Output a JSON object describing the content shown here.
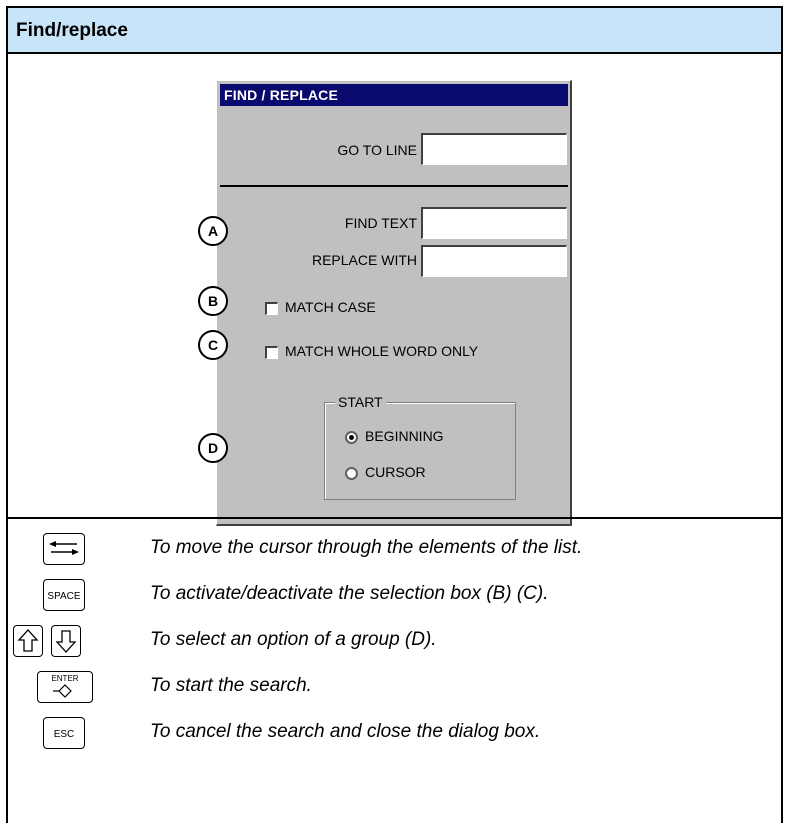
{
  "header": {
    "title": "Find/replace"
  },
  "dialog": {
    "title": "FIND / REPLACE",
    "goto_label": "GO TO LINE",
    "goto_value": "",
    "find_label": "FIND TEXT",
    "find_value": "",
    "replace_label": "REPLACE WITH",
    "replace_value": "",
    "match_case": {
      "label": "MATCH CASE",
      "checked": false
    },
    "whole_word": {
      "label": "MATCH WHOLE WORD ONLY",
      "checked": false
    },
    "start_group": {
      "title": "START",
      "options": [
        {
          "label": "BEGINNING",
          "selected": true
        },
        {
          "label": "CURSOR",
          "selected": false
        }
      ]
    }
  },
  "callouts": {
    "a": "A",
    "b": "B",
    "c": "C",
    "d": "D"
  },
  "keys": {
    "space": "SPACE",
    "enter": "ENTER",
    "esc": "ESC"
  },
  "descriptions": [
    "To move the cursor through the elements of the list.",
    "To activate/deactivate the selection box (B) (C).",
    "To select an option of a group (D).",
    "To start the search.",
    "To cancel the search and close the dialog box."
  ],
  "icons": [
    "tab-arrows-icon",
    "arrow-up-icon",
    "arrow-down-icon",
    "enter-arrow-icon"
  ]
}
